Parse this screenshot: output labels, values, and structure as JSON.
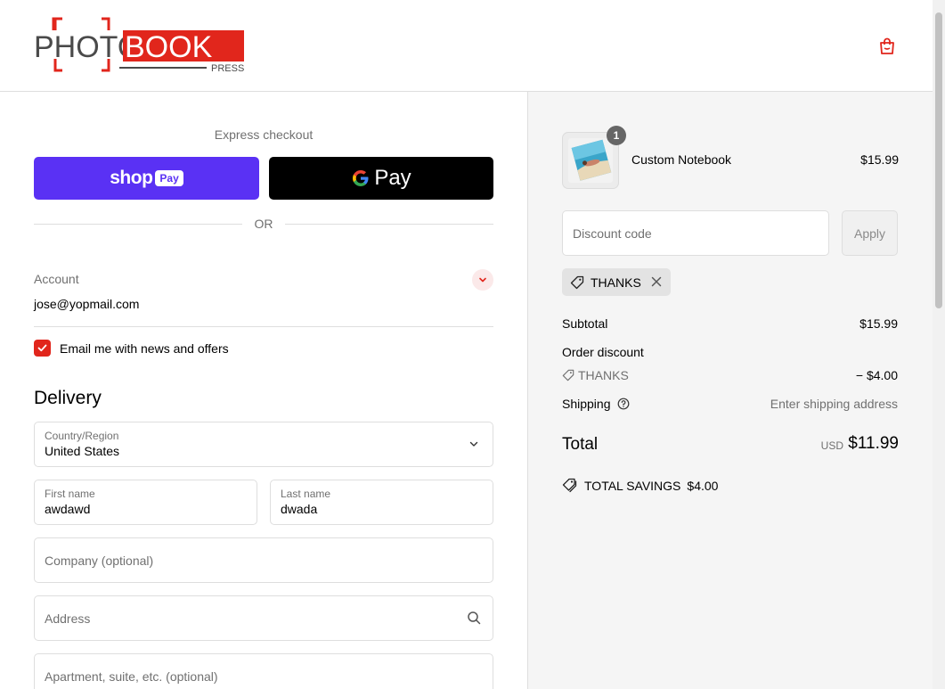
{
  "header": {
    "logo_text_left": "PHOTO",
    "logo_text_right": "BOOK",
    "logo_sub": "PRESS",
    "brand_color": "#e1261c",
    "cart_icon": "shopping-bag-icon"
  },
  "express": {
    "title": "Express checkout",
    "shop_pay": {
      "shop_label": "shop",
      "pay_label": "Pay",
      "color": "#5a31f4"
    },
    "gpay": {
      "g_label": "G",
      "pay_label": "Pay"
    },
    "or_label": "OR"
  },
  "account": {
    "label": "Account",
    "email": "jose@yopmail.com",
    "toggle_icon": "chevron-down-icon"
  },
  "newsletter": {
    "label": "Email me with news and offers",
    "checked": true
  },
  "delivery": {
    "title": "Delivery",
    "country": {
      "label": "Country/Region",
      "value": "United States"
    },
    "first_name": {
      "label": "First name",
      "value": "awdawd"
    },
    "last_name": {
      "label": "Last name",
      "value": "dwada"
    },
    "company": {
      "placeholder": "Company (optional)"
    },
    "address": {
      "placeholder": "Address",
      "icon": "search-icon"
    },
    "apartment": {
      "placeholder": "Apartment, suite, etc. (optional)"
    }
  },
  "summary": {
    "item": {
      "name": "Custom Notebook",
      "price": "$15.99",
      "quantity": "1"
    },
    "discount": {
      "placeholder": "Discount code",
      "apply_label": "Apply"
    },
    "applied_code": "THANKS",
    "subtotal": {
      "label": "Subtotal",
      "value": "$15.99"
    },
    "order_discount": {
      "label": "Order discount",
      "code": "THANKS",
      "value": "− $4.00"
    },
    "shipping": {
      "label": "Shipping",
      "value": "Enter shipping address"
    },
    "total": {
      "label": "Total",
      "currency": "USD",
      "value": "$11.99"
    },
    "savings": {
      "label": "TOTAL SAVINGS",
      "value": "$4.00"
    }
  }
}
